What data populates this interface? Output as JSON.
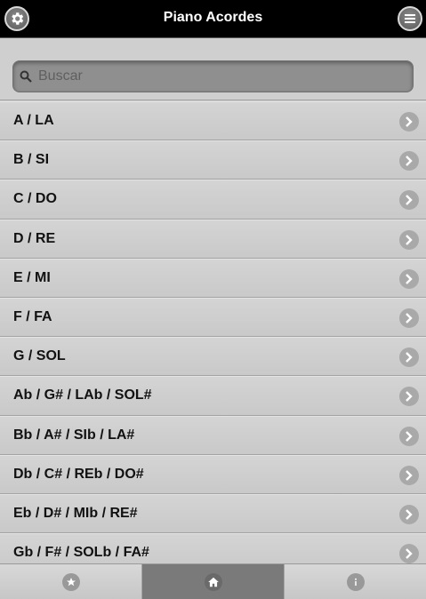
{
  "header": {
    "title": "Piano Acordes",
    "left_icon": "gear-icon",
    "right_icon": "menu-icon"
  },
  "search": {
    "placeholder": "Buscar",
    "value": ""
  },
  "list": {
    "items": [
      {
        "label": "A / LA"
      },
      {
        "label": "B / SI"
      },
      {
        "label": "C / DO"
      },
      {
        "label": "D / RE"
      },
      {
        "label": "E / MI"
      },
      {
        "label": "F / FA"
      },
      {
        "label": "G / SOL"
      },
      {
        "label": "Ab / G# / LAb / SOL#"
      },
      {
        "label": "Bb / A# / SIb / LA#"
      },
      {
        "label": "Db / C# / REb / DO#"
      },
      {
        "label": "Eb / D# / MIb / RE#"
      },
      {
        "label": "Gb / F# / SOLb / FA#"
      }
    ]
  },
  "footer": {
    "tabs": [
      {
        "icon": "star-icon",
        "active": false
      },
      {
        "icon": "home-icon",
        "active": true
      },
      {
        "icon": "info-icon",
        "active": false
      }
    ]
  },
  "colors": {
    "header_bg": "#000000",
    "list_bg": "#cfcfcf",
    "active_tab": "#7a7a7a"
  }
}
